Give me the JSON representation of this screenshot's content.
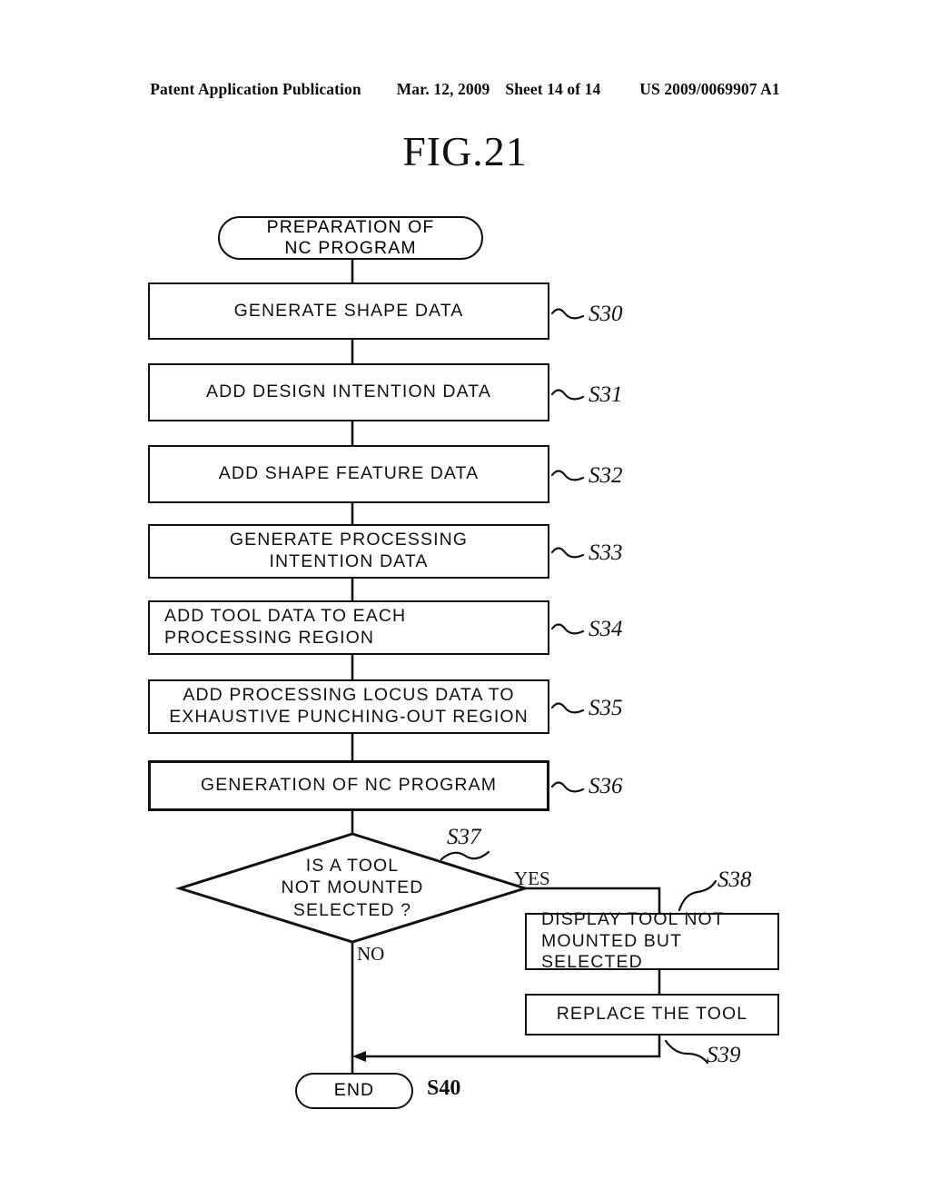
{
  "header": {
    "publication": "Patent Application Publication",
    "date": "Mar. 12, 2009",
    "sheet": "Sheet 14 of 14",
    "doc_number": "US 2009/0069907 A1"
  },
  "figure": {
    "title": "FIG.21"
  },
  "colors": {
    "ink": "#111111",
    "paper": "#ffffff"
  },
  "flowchart": {
    "start": {
      "id": "start",
      "shape": "terminator",
      "text": "PREPARATION OF\nNC PROGRAM"
    },
    "steps": [
      {
        "id": "s30",
        "shape": "process",
        "text": "GENERATE SHAPE DATA",
        "label": "S30",
        "align": "center"
      },
      {
        "id": "s31",
        "shape": "process",
        "text": "ADD DESIGN INTENTION DATA",
        "label": "S31",
        "align": "center"
      },
      {
        "id": "s32",
        "shape": "process",
        "text": "ADD SHAPE FEATURE DATA",
        "label": "S32",
        "align": "center"
      },
      {
        "id": "s33",
        "shape": "process",
        "text": "GENERATE PROCESSING\nINTENTION DATA",
        "label": "S33",
        "align": "center"
      },
      {
        "id": "s34",
        "shape": "process",
        "text": "ADD TOOL DATA TO EACH\nPROCESSING REGION",
        "label": "S34",
        "align": "left"
      },
      {
        "id": "s35",
        "shape": "process",
        "text": "ADD PROCESSING LOCUS DATA TO\nEXHAUSTIVE PUNCHING-OUT REGION",
        "label": "S35",
        "align": "center"
      },
      {
        "id": "s36",
        "shape": "process",
        "text": "GENERATION OF NC PROGRAM",
        "label": "S36",
        "align": "center"
      }
    ],
    "decision": {
      "id": "s37",
      "shape": "decision",
      "text": "IS A TOOL\nNOT MOUNTED\nSELECTED ?",
      "label": "S37",
      "yes_label": "YES",
      "no_label": "NO"
    },
    "branch_steps": [
      {
        "id": "s38",
        "shape": "process",
        "text": "DISPLAY TOOL NOT\nMOUNTED BUT SELECTED",
        "label": "S38",
        "align": "left"
      },
      {
        "id": "s39",
        "shape": "process",
        "text": "REPLACE THE TOOL",
        "label": "S39",
        "align": "center"
      }
    ],
    "end": {
      "id": "s40",
      "shape": "terminator",
      "text": "END",
      "label": "S40"
    }
  }
}
